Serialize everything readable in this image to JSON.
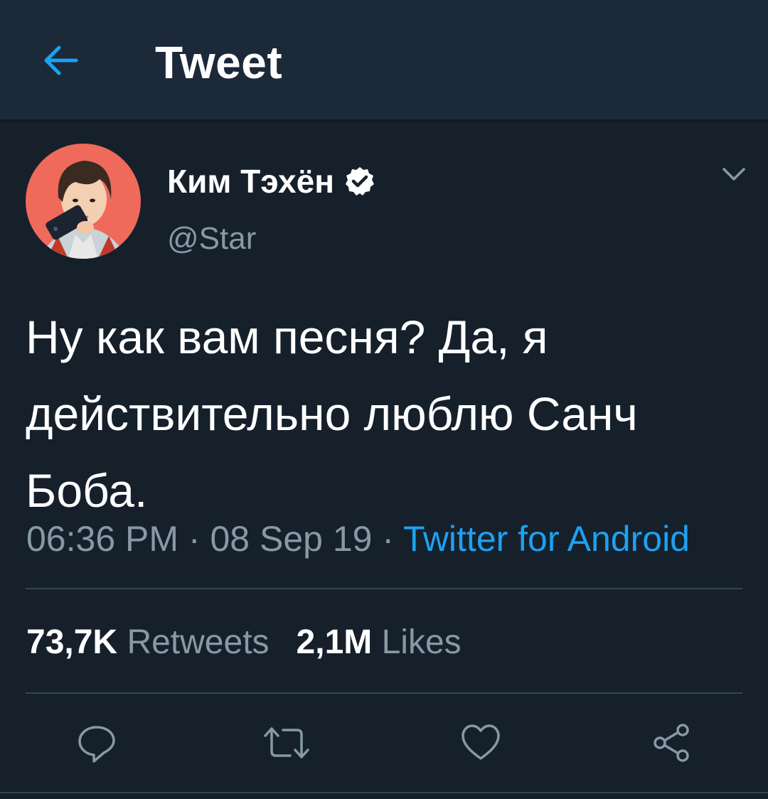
{
  "header": {
    "title": "Tweet",
    "back_icon": "arrow-left-icon",
    "accent_color": "#1da1f2"
  },
  "tweet": {
    "display_name": "Ким Тэхён",
    "handle": "@Star",
    "verified": true,
    "text": "Ну как вам песня? Да, я действительно люблю Санч Боба.",
    "time": "06:36 PM",
    "date": "08 Sep 19",
    "separator": "·",
    "source": "Twitter for Android"
  },
  "stats": {
    "retweets_count": "73,7K",
    "retweets_label": "Retweets",
    "likes_count": "2,1M",
    "likes_label": "Likes"
  },
  "actions": [
    "reply-icon",
    "retweet-icon",
    "like-icon",
    "share-icon"
  ]
}
